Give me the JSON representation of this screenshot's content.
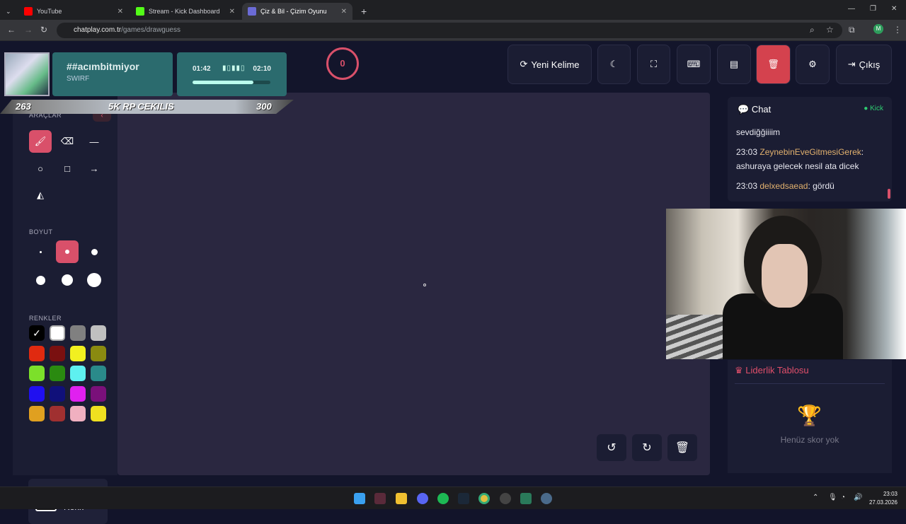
{
  "browser": {
    "tabs": [
      {
        "title": "YouTube",
        "color": "#ff0000"
      },
      {
        "title": "Stream - Kick Dashboard",
        "color": "#53fc18"
      },
      {
        "title": "Çiz & Bil - Çizim Oyunu",
        "color": "#6b6bd6"
      }
    ],
    "url_host": "chatplay.com.tr",
    "url_path": "/games/drawguess",
    "profile_initial": "M"
  },
  "overlay": {
    "username": "##acımbitmiyor",
    "subtitle": "SWIRF",
    "time_elapsed": "01:42",
    "time_total": "02:10",
    "progress": 0.78,
    "rp_left": "263",
    "rp_title": "5K RP CEKILIS",
    "rp_right": "300"
  },
  "score": "0",
  "toolbar": {
    "new_word": "Yeni Kelime",
    "exit": "Çıkış"
  },
  "tools": {
    "section_tools": "ARAÇLAR",
    "section_size": "BOYUT",
    "section_colors": "RENKLER",
    "custom_color": "Özel Renk",
    "colors": [
      "#000000",
      "#ffffff",
      "#808080",
      "#c0c0c0",
      "#e02a10",
      "#7a1010",
      "#f2f020",
      "#8a8a10",
      "#7ce02a",
      "#2a8a10",
      "#5ef0f0",
      "#2a8a8a",
      "#2010f0",
      "#10107a",
      "#e020f0",
      "#7a107a",
      "#e0a020",
      "#a03030",
      "#f0b0c0",
      "#f0e020"
    ]
  },
  "chat": {
    "title": "Chat",
    "source": "Kick",
    "messages": [
      {
        "time": "",
        "user": "",
        "text": "sevdiğğiiiim"
      },
      {
        "time": "23:03",
        "user": "ZeynebinEveGitmesiGerek",
        "text": "ashuraya gelecek nesil ata dicek"
      },
      {
        "time": "23:03",
        "user": "delxedsaead",
        "text": "gördü"
      }
    ]
  },
  "leaderboard": {
    "title": "Liderlik Tablosu",
    "empty": "Henüz skor yok"
  },
  "taskbar": {
    "time": "23:03",
    "date": "27.03.2026"
  }
}
